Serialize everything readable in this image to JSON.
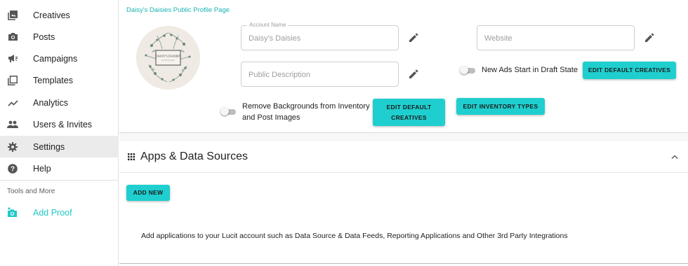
{
  "sidebar": {
    "items": [
      {
        "label": "Creatives",
        "icon": "photo-library-icon"
      },
      {
        "label": "Posts",
        "icon": "camera-icon"
      },
      {
        "label": "Campaigns",
        "icon": "megaphone-icon"
      },
      {
        "label": "Templates",
        "icon": "template-icon"
      },
      {
        "label": "Analytics",
        "icon": "trending-line-icon"
      },
      {
        "label": "Users & Invites",
        "icon": "people-icon"
      },
      {
        "label": "Settings",
        "icon": "gear-icon",
        "active": true
      },
      {
        "label": "Help",
        "icon": "help-circle-icon"
      }
    ],
    "tools_header": "Tools and More",
    "tools_items": [
      {
        "label": "Add Proof",
        "icon": "add-photo-icon"
      }
    ]
  },
  "profile": {
    "title": "Daisy's Daisies Public Profile Page",
    "avatar_text": "DAISY'S DAISIES",
    "account_name_legend": "Account Name",
    "account_name_value": "Daisy's Daisies",
    "website_placeholder": "Website",
    "description_placeholder": "Public Description",
    "draft_toggle_label": "New Ads Start in Draft State",
    "edit_default_creatives_label": "EDIT DEFAULT CREATIVES",
    "remove_bg_label_line1": "Remove Backgrounds from Inventory",
    "remove_bg_label_line2": "and Post Images",
    "edit_default_creatives_2_line1": "EDIT DEFAULT",
    "edit_default_creatives_2_line2": "CREATIVES",
    "edit_inventory_types_label": "EDIT INVENTORY TYPES"
  },
  "apps_section": {
    "title": "Apps & Data Sources",
    "add_new_label": "ADD NEW",
    "description": "Add applications to your Lucit account such as Data Source & Data Feeds, Reporting Applications and Other 3rd Party Integrations"
  },
  "colors": {
    "accent": "#1fcfcf",
    "link_teal": "#1ab4b4",
    "active_bg": "#ebebeb"
  }
}
